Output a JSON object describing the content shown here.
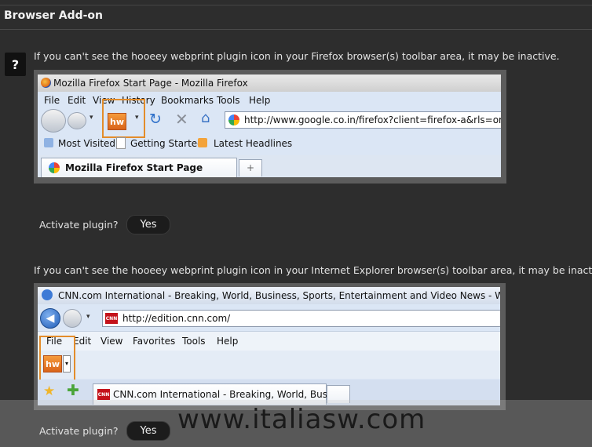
{
  "section_title": "Browser Add-on",
  "help_badge": "?",
  "firefox": {
    "intro": "If you can't see the hooeey webprint plugin icon in your Firefox browser(s) toolbar area, it may be inactive.",
    "window_title": "Mozilla Firefox Start Page - Mozilla Firefox",
    "menu": [
      "File",
      "Edit",
      "View",
      "History",
      "Bookmarks",
      "Tools",
      "Help"
    ],
    "url": "http://www.google.co.in/firefox?client=firefox-a&rls=org.mo",
    "bookmarks": [
      "Most Visited",
      "Getting Started",
      "Latest Headlines"
    ],
    "tab_label": "Mozilla Firefox Start Page",
    "new_tab": "+",
    "plugin_icon_text": "hw",
    "activate_label": "Activate plugin?",
    "yes_label": "Yes"
  },
  "ie": {
    "intro": "If you can't see the hooeey webprint plugin icon in your Internet Explorer browser(s) toolbar area, it may be inactive.",
    "window_title": "CNN.com International - Breaking, World, Business, Sports, Entertainment and Video News - Windows Internet Explorer",
    "url": "http://edition.cnn.com/",
    "menu": [
      "File",
      "Edit",
      "View",
      "Favorites",
      "Tools",
      "Help"
    ],
    "tab_label": "CNN.com International - Breaking, World, Busine...",
    "cnn_logo": "CNN",
    "plugin_icon_text": "hw",
    "activate_label": "Activate plugin?",
    "yes_label": "Yes"
  },
  "watermark": "www.italiasw.com",
  "colors": {
    "background": "#2d2d2d",
    "highlight": "#e38c2a",
    "plugin_orange": "#f08a2c"
  }
}
